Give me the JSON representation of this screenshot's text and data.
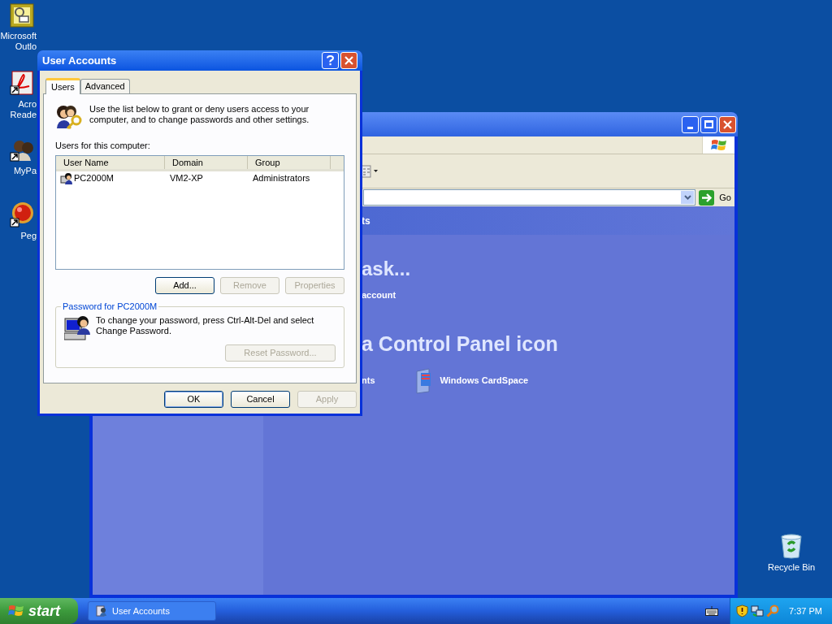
{
  "desktop_icons": [
    {
      "kind": "outlook",
      "lines": [
        "Microsoft",
        "Outlo"
      ]
    },
    {
      "kind": "acrobat",
      "lines": [
        "Acro",
        "Reade"
      ]
    },
    {
      "kind": "people",
      "lines": [
        "MyPa"
      ]
    },
    {
      "kind": "ball",
      "lines": [
        "Peg"
      ]
    },
    {
      "kind": "recycle",
      "lines": [
        "Recycle Bin"
      ]
    }
  ],
  "control_panel": {
    "go_label": "Go",
    "header": "ts",
    "heading_1": "ask...",
    "link_1": "account",
    "heading_2": "a Control Panel icon",
    "items": [
      {
        "kind": "plain",
        "label": "nts"
      },
      {
        "kind": "cardspace",
        "label": "Windows CardSpace"
      }
    ]
  },
  "dialog": {
    "title": "User Accounts",
    "tabs": [
      {
        "label": "Users",
        "selected": true
      },
      {
        "label": "Advanced",
        "selected": false
      }
    ],
    "intro": "Use the list below to grant or deny users access to your computer, and to change passwords and other settings.",
    "users_label": "Users for this computer:",
    "columns": [
      "User Name",
      "Domain",
      "Group"
    ],
    "rows": [
      {
        "user_name": "PC2000M",
        "domain": "VM2-XP",
        "group": "Administrators",
        "selected": false
      }
    ],
    "list_buttons": [
      {
        "label": "Add...",
        "disabled": false
      },
      {
        "label": "Remove",
        "disabled": true
      },
      {
        "label": "Properties",
        "disabled": true
      }
    ],
    "password_group": {
      "title": "Password for PC2000M",
      "text": "To change your password, press Ctrl-Alt-Del and select Change Password.",
      "button": {
        "label": "Reset Password...",
        "disabled": true
      }
    },
    "footer_buttons": [
      {
        "label": "OK",
        "disabled": false,
        "default": true
      },
      {
        "label": "Cancel",
        "disabled": false,
        "default": false
      },
      {
        "label": "Apply",
        "disabled": true,
        "default": false
      }
    ]
  },
  "taskbar": {
    "start": "start",
    "tasks": [
      {
        "label": "User Accounts",
        "selected": false
      }
    ],
    "clock": "7:37 PM"
  }
}
